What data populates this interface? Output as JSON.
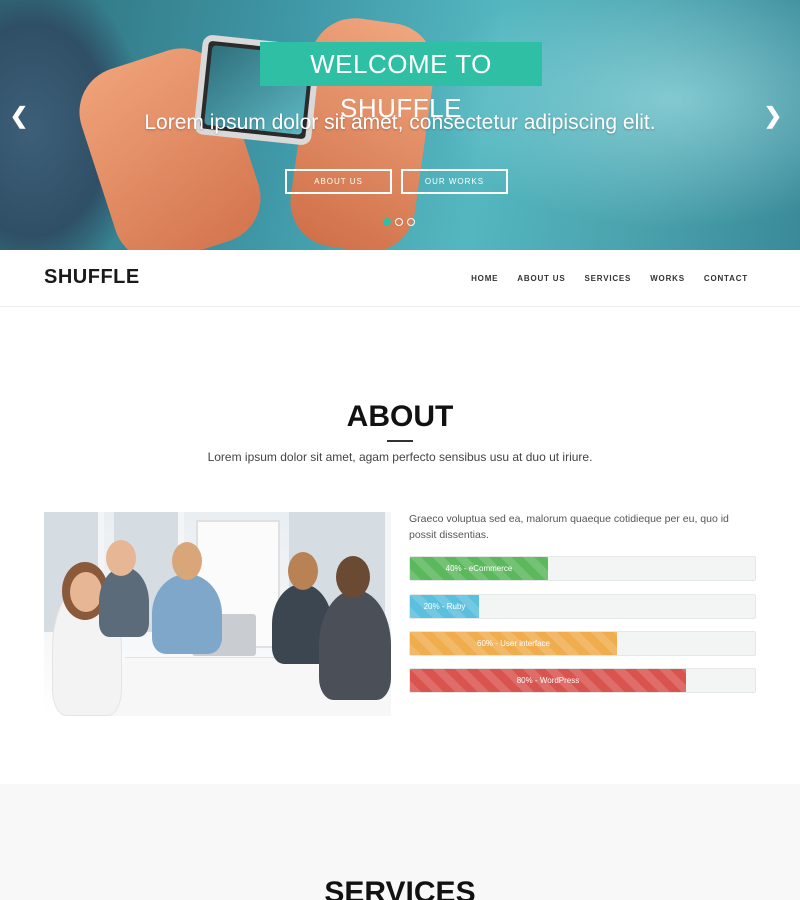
{
  "hero": {
    "title": "WELCOME TO SHUFFLE",
    "subtitle": "Lorem ipsum dolor sit amet, consectetur adipiscing elit.",
    "buttons": [
      {
        "label": "ABOUT US"
      },
      {
        "label": "OUR WORKS"
      }
    ],
    "prev_arrow": "❮",
    "next_arrow": "❯",
    "slides": 3,
    "active_slide": 1,
    "accent_color": "#2ebfa5"
  },
  "nav": {
    "brand": "SHUFFLE",
    "items": [
      {
        "label": "HOME"
      },
      {
        "label": "ABOUT US"
      },
      {
        "label": "SERVICES"
      },
      {
        "label": "WORKS"
      },
      {
        "label": "CONTACT"
      }
    ]
  },
  "about": {
    "title": "ABOUT",
    "lead": "Lorem ipsum dolor sit amet, agam perfecto sensibus usu at duo ut iriure.",
    "text": "Graeco voluptua sed ea, malorum quaeque cotidieque per eu, quo id possit dissentias.",
    "skills": [
      {
        "label": "40% - eCommerce",
        "percent": 40,
        "color": "#5cb85c"
      },
      {
        "label": "20% - Ruby",
        "percent": 20,
        "color": "#5bc0de"
      },
      {
        "label": "60% - User interface",
        "percent": 60,
        "color": "#f0ad4e"
      },
      {
        "label": "80% - WordPress",
        "percent": 80,
        "color": "#d9534f"
      }
    ]
  },
  "services": {
    "title": "SERVICES"
  }
}
